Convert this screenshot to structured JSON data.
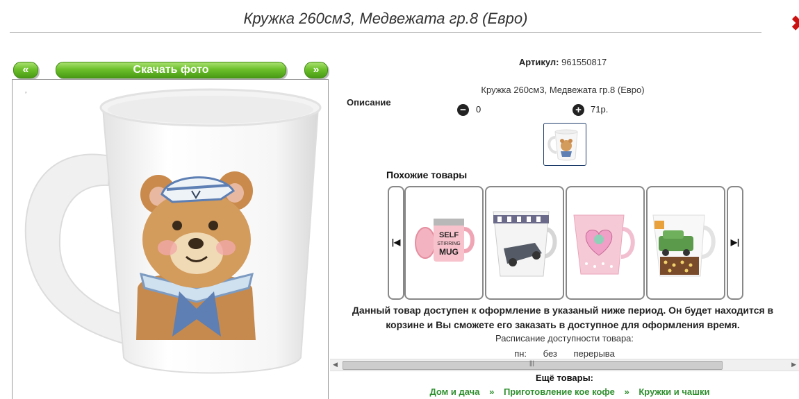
{
  "header": {
    "title": "Кружка 260см3, Медвежата гр.8 (Евро)"
  },
  "gallery": {
    "prev_label": "«",
    "download_label": "Скачать фото",
    "next_label": "»"
  },
  "product": {
    "article_label": "Артикул:",
    "article_value": "961550817",
    "description_label": "Описание",
    "description_text": "Кружка 260см3, Медвежата гр.8 (Евро)",
    "quantity": "0",
    "price": "71р."
  },
  "similar": {
    "title": "Похожие товары",
    "items": [
      {
        "name": "self-stirring-mug",
        "text1": "SELF",
        "text2": "STIRRING",
        "text3": "MUG"
      },
      {
        "name": "car-mug"
      },
      {
        "name": "heart-mug"
      },
      {
        "name": "coffee-car-mug"
      }
    ]
  },
  "notice": {
    "line1": "Данный товар доступен к оформление в указаный ниже период. Он будет находится в",
    "line2": "корзине и Вы сможете его заказать в доступное для оформления время."
  },
  "schedule": {
    "title": "Расписание доступности товара:",
    "day": "пн:",
    "col1": "без",
    "col2": "перерыва"
  },
  "more": {
    "title": "Ещё товары:",
    "crumbs": [
      "Дом и дача",
      "»",
      "Приготовление кое кофе",
      "»",
      "Кружки и чашки"
    ]
  },
  "colors": {
    "accent_green": "#6cc02a",
    "link_green": "#2f8f2f",
    "close_red": "#cc1111"
  }
}
